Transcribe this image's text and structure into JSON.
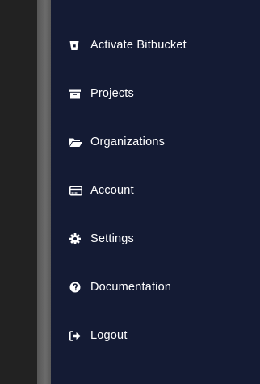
{
  "colors": {
    "panel_bg": "#141b34",
    "backdrop": "#222222",
    "text": "#ffffff"
  },
  "menu": {
    "items": [
      {
        "label": "Activate Bitbucket",
        "icon": "bitbucket-icon"
      },
      {
        "label": "Projects",
        "icon": "archive-box-icon"
      },
      {
        "label": "Organizations",
        "icon": "folder-open-icon"
      },
      {
        "label": "Account",
        "icon": "credit-card-icon"
      },
      {
        "label": "Settings",
        "icon": "gear-icon"
      },
      {
        "label": "Documentation",
        "icon": "question-circle-icon"
      },
      {
        "label": "Logout",
        "icon": "sign-out-icon"
      }
    ]
  }
}
